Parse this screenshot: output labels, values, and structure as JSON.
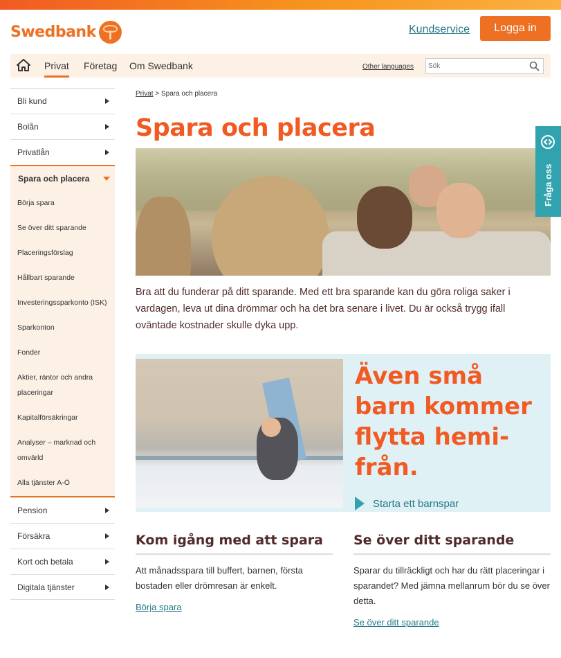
{
  "header": {
    "logo_text": "Swedbank",
    "kundservice_label": "Kundservice",
    "login_label": "Logga in",
    "brand_color": "#ee7023"
  },
  "nav": {
    "home_icon": "home-icon",
    "items": [
      {
        "label": "Privat",
        "active": true
      },
      {
        "label": "Företag",
        "active": false
      },
      {
        "label": "Om Swedbank",
        "active": false
      }
    ],
    "other_languages": "Other languages",
    "search_placeholder": "Sök"
  },
  "sidebar": {
    "top_items": [
      "Bli kund",
      "Bolån",
      "Privatlån"
    ],
    "open_item": "Spara och placera",
    "sub_items": [
      "Börja spara",
      "Se över ditt sparande",
      "Placeringsförslag",
      "Hållbart sparande",
      "Investeringssparkonto (ISK)",
      "Sparkonton",
      "Fonder",
      "Aktier, räntor och andra placeringar",
      "Kapitalförsäkringar",
      "Analyser – marknad och omvärld",
      "Alla tjänster A-Ö"
    ],
    "bottom_items": [
      "Pension",
      "Försäkra",
      "Kort och betala",
      "Digitala tjänster"
    ]
  },
  "breadcrumb": {
    "home": "Privat",
    "separator": ">",
    "current": "Spara och placera"
  },
  "main": {
    "title": "Spara och placera",
    "intro": "Bra att du funderar på ditt sparande. Med ett bra sparande kan du göra roliga saker i vardagen, leva ut dina drömmar och ha det bra senare i livet. Du är också trygg ifall oväntade kostnader skulle dyka upp.",
    "promo": {
      "heading": "Även små barn kommer flytta hemi-från.",
      "link": "Starta ett barnspar"
    },
    "columns": [
      {
        "title": "Kom igång med att spara",
        "text": "Att månadsspara till buffert, barnen, första bostaden eller drömresan är enkelt.",
        "link": "Börja spara"
      },
      {
        "title": "Se över ditt sparande",
        "text": "Sparar du tillräckligt och har du rätt placeringar i sparandet? Med jämna mellanrum bör du se över detta.",
        "link": "Se över ditt sparande"
      }
    ]
  },
  "feedback": {
    "label": "Fråga oss",
    "icon": "chat-arrows-icon"
  }
}
